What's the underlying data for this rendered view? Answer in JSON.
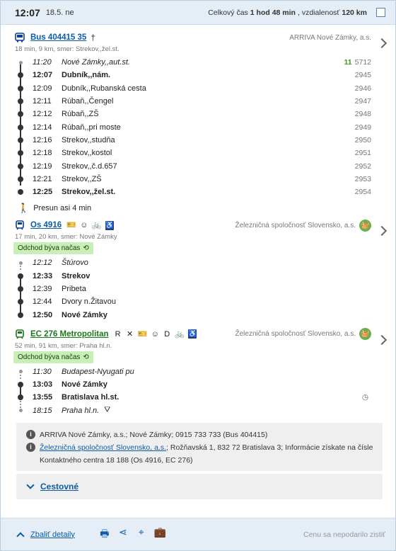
{
  "header": {
    "time": "12:07",
    "date": "18.5. ne",
    "total_label": "Celkový čas",
    "total_value": "1 hod 48 min",
    "distance_label": ", vzdialenosť",
    "distance_value": "120 km"
  },
  "connections": [
    {
      "mode_icon": "bus-icon",
      "name": "Bus 404415 35",
      "mark": "†",
      "operator": "ARRIVA Nové Zámky, a.s.",
      "info": "18 min, 9 km, smer: Strekov,,žel.st.",
      "stops": [
        {
          "time": "11:20",
          "name": "Nové Zámky,,aut.st.",
          "km_green": "11",
          "km": "5712",
          "style": "ital"
        },
        {
          "time": "12:07",
          "name": "Dubník,,nám.",
          "km": "2945",
          "style": "bold"
        },
        {
          "time": "12:09",
          "name": "Dubník,,Rubanská cesta",
          "km": "2946",
          "style": ""
        },
        {
          "time": "12:11",
          "name": "Rúbaň,,Čengel",
          "km": "2947",
          "style": ""
        },
        {
          "time": "12:12",
          "name": "Rúbaň,,ZŠ",
          "km": "2948",
          "style": ""
        },
        {
          "time": "12:14",
          "name": "Rúbaň,,pri moste",
          "km": "2949",
          "style": ""
        },
        {
          "time": "12:16",
          "name": "Strekov,,studňa",
          "km": "2950",
          "style": ""
        },
        {
          "time": "12:18",
          "name": "Strekov,,kostol",
          "km": "2951",
          "style": ""
        },
        {
          "time": "12:19",
          "name": "Strekov,,č.d.657",
          "km": "2952",
          "style": ""
        },
        {
          "time": "12:21",
          "name": "Strekov,,ZŠ",
          "km": "2953",
          "style": ""
        },
        {
          "time": "12:25",
          "name": "Strekov,,žel.st.",
          "km": "2954",
          "style": "bold"
        }
      ]
    },
    {
      "mode_icon": "train-icon",
      "name": "Os 4916",
      "operator": "Železničná spoločnosť Slovensko, a.s.",
      "info": "17 min, 20 km, smer: Nové Zámky",
      "badge": "Odchod býva načas",
      "stops": [
        {
          "time": "12:12",
          "name": "Štúrovo",
          "style": "ital"
        },
        {
          "time": "12:33",
          "name": "Strekov",
          "style": "bold"
        },
        {
          "time": "12:39",
          "name": "Pribeta",
          "style": ""
        },
        {
          "time": "12:44",
          "name": "Dvory n.Žitavou",
          "style": ""
        },
        {
          "time": "12:50",
          "name": "Nové Zámky",
          "style": "bold"
        }
      ]
    },
    {
      "mode_icon": "train-icon",
      "name": "EC 276 Metropolitan",
      "operator": "Železničná spoločnosť Slovensko, a.s.",
      "info": "52 min, 91 km, smer: Praha hl.n.",
      "badge": "Odchod býva načas",
      "stops": [
        {
          "time": "11:30",
          "name": "Budapest-Nyugati pu",
          "style": "ital"
        },
        {
          "time": "13:03",
          "name": "Nové Zámky",
          "style": "bold"
        },
        {
          "time": "13:55",
          "name": "Bratislava hl.st.",
          "style": "bold"
        },
        {
          "time": "18:15",
          "name": "Praha hl.n.",
          "style": "ital"
        }
      ]
    }
  ],
  "walk": "Presun asi 4 min",
  "feature_letters": {
    "r": "R",
    "d": "D"
  },
  "info_box": {
    "line1": "ARRIVA Nové Zámky, a.s.; Nové Zámky; 0915 733 733 (Bus 404415)",
    "line2_link": "Železničná spoločnosť Slovensko, a.s.",
    "line2_rest": "; Rožňavská 1, 832 72 Bratislava 3; Informácie získate na čísle Kontaktného centra 18 188 (Os 4916, EC 276)"
  },
  "fare_label": "Cestovné",
  "footer": {
    "collapse": "Zbaliť detaily",
    "price_note": "Cenu sa nepodarilo zistiť"
  },
  "colors": {
    "link": "#0a5ca8",
    "green_line": "#1a7a1a",
    "badge_bg": "#c9efb8",
    "header_bg": "#e5eef7"
  }
}
